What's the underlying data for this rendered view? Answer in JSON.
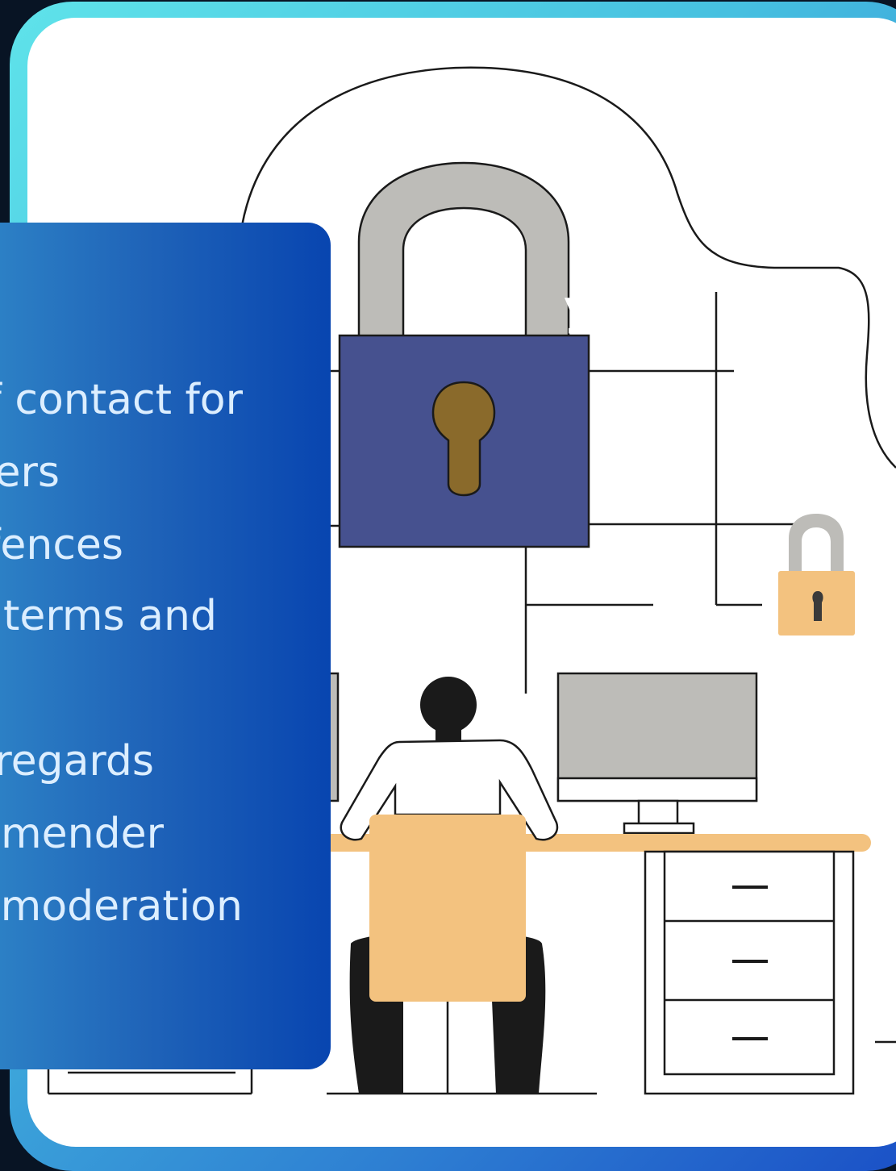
{
  "panel": {
    "title": "y",
    "lines": [
      "f contact for",
      "ers",
      "fences",
      "terms and",
      "regards",
      "mender",
      "moderation"
    ]
  },
  "colors": {
    "background": "#081424",
    "frame_light": "#5fe3ea",
    "frame_dark": "#1a4fc6",
    "panel_start": "#2f86c8",
    "panel_end": "#0845b0",
    "lock_body": "#46518f",
    "lock_shackle": "#bdbcb8",
    "keyhole": "#8a6a2b",
    "small_lock": "#f3c27f",
    "desk": "#f3c27f",
    "chair": "#f3c27f",
    "monitor": "#bdbcb8"
  },
  "icons": [
    "large-padlock-icon",
    "small-padlock-icon",
    "monitor-icon",
    "desk-icon",
    "person-icon",
    "chair-icon"
  ]
}
